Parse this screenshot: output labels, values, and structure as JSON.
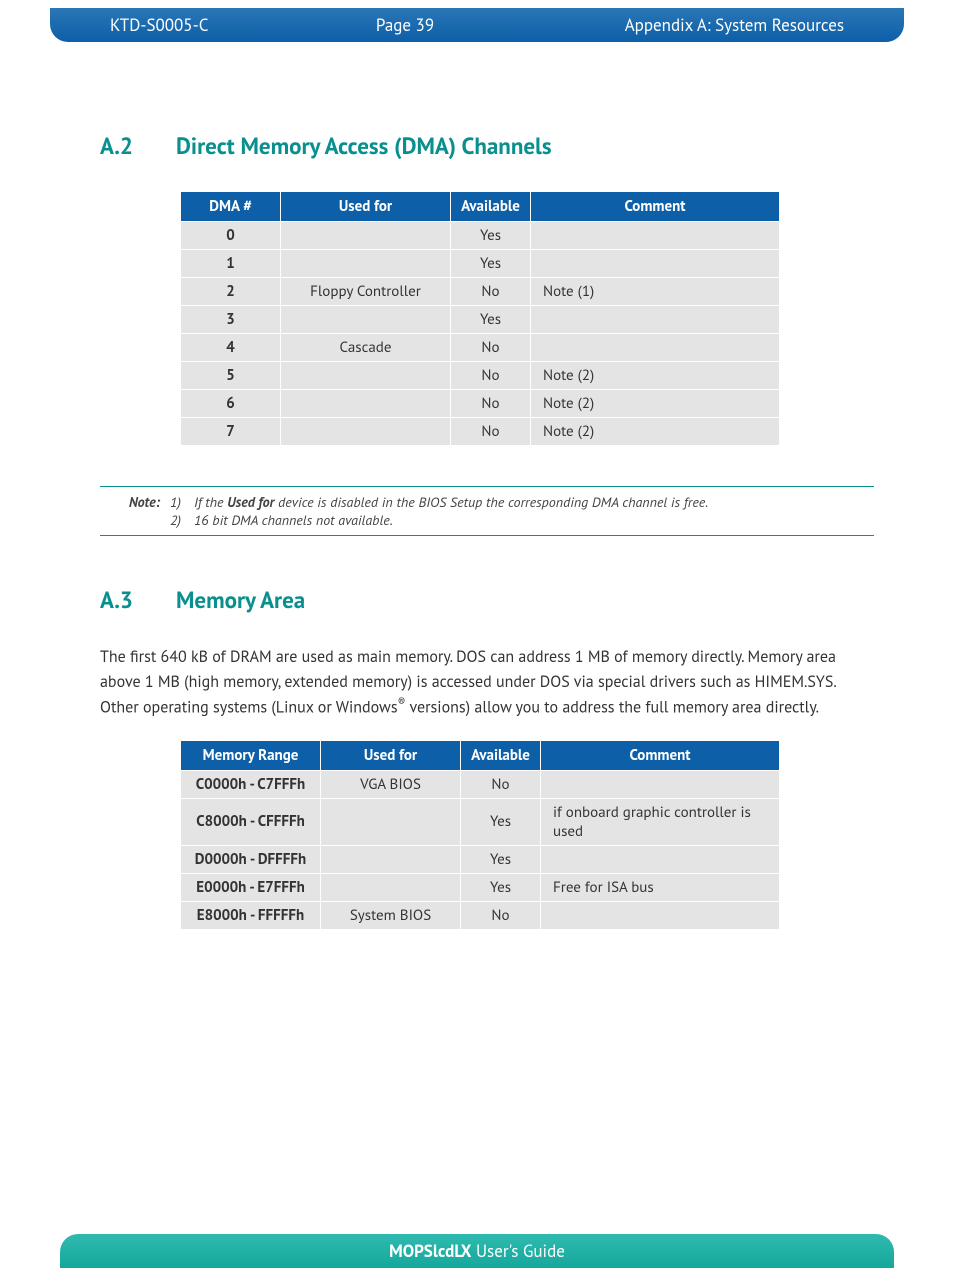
{
  "header": {
    "doc_id": "KTD-S0005-C",
    "page": "Page 39",
    "appendix": "Appendix A: System Resources"
  },
  "sectionA2": {
    "num": "A.2",
    "title": "Direct Memory Access (DMA) Channels",
    "headers": {
      "c1": "DMA #",
      "c2": "Used for",
      "c3": "Available",
      "c4": "Comment"
    },
    "rows": [
      {
        "dma": "0",
        "used": "",
        "avail": "Yes",
        "comment": ""
      },
      {
        "dma": "1",
        "used": "",
        "avail": "Yes",
        "comment": ""
      },
      {
        "dma": "2",
        "used": "Floppy Controller",
        "avail": "No",
        "comment": "Note (1)"
      },
      {
        "dma": "3",
        "used": "",
        "avail": "Yes",
        "comment": ""
      },
      {
        "dma": "4",
        "used": "Cascade",
        "avail": "No",
        "comment": ""
      },
      {
        "dma": "5",
        "used": "",
        "avail": "No",
        "comment": "Note (2)"
      },
      {
        "dma": "6",
        "used": "",
        "avail": "No",
        "comment": "Note (2)"
      },
      {
        "dma": "7",
        "used": "",
        "avail": "No",
        "comment": "Note (2)"
      }
    ]
  },
  "note": {
    "label": "Note:",
    "n1_num": "1)",
    "n1_pre": "If the ",
    "n1_bold": "Used for",
    "n1_post": " device is disabled in the BIOS Setup the corresponding DMA channel is free.",
    "n2_num": "2)",
    "n2_text": "16 bit DMA channels not available."
  },
  "sectionA3": {
    "num": "A.3",
    "title": "Memory Area",
    "paragraph": "The first 640 kB of DRAM are used as main memory. DOS can address 1 MB of memory directly. Memory area above 1 MB (high memory, extended memory) is accessed under DOS via special drivers such as HIMEM.SYS. Other operating systems (Linux or Windows® versions) allow you to address the full memory area directly.",
    "headers": {
      "c1": "Memory Range",
      "c2": "Used for",
      "c3": "Available",
      "c4": "Comment"
    },
    "rows": [
      {
        "range": "C0000h - C7FFFh",
        "used": "VGA BIOS",
        "avail": "No",
        "comment": ""
      },
      {
        "range": "C8000h - CFFFFh",
        "used": "",
        "avail": "Yes",
        "comment": "if onboard graphic controller is used"
      },
      {
        "range": "D0000h - DFFFFh",
        "used": "",
        "avail": "Yes",
        "comment": ""
      },
      {
        "range": "E0000h - E7FFFh",
        "used": "",
        "avail": "Yes",
        "comment": "Free for ISA bus"
      },
      {
        "range": "E8000h - FFFFFh",
        "used": "System BIOS",
        "avail": "No",
        "comment": ""
      }
    ]
  },
  "footer": {
    "bold": "MOPSlcdLX",
    "rest": " User's Guide"
  }
}
